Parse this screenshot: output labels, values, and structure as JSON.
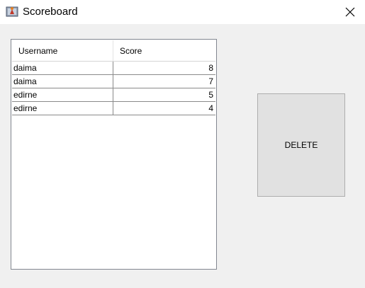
{
  "window": {
    "title": "Scoreboard",
    "app_icon": "java-cup-icon",
    "close_icon": "close-icon"
  },
  "table": {
    "columns": [
      "Username",
      "Score"
    ],
    "rows": [
      {
        "username": "daima",
        "score": "8"
      },
      {
        "username": "daima",
        "score": "7"
      },
      {
        "username": "edirne",
        "score": "5"
      },
      {
        "username": "edirne",
        "score": "4"
      }
    ]
  },
  "actions": {
    "delete_label": "DELETE"
  }
}
